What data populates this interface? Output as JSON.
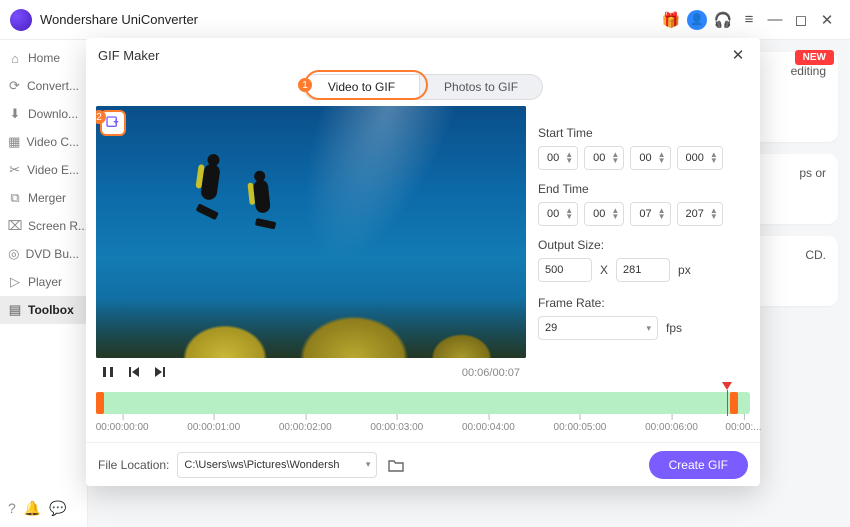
{
  "titlebar": {
    "app_name": "Wondershare UniConverter"
  },
  "sidebar": {
    "items": [
      {
        "label": "Home",
        "icon": "⌂"
      },
      {
        "label": "Convert...",
        "icon": "⟳"
      },
      {
        "label": "Downlo...",
        "icon": "⬇"
      },
      {
        "label": "Video C...",
        "icon": "▦"
      },
      {
        "label": "Video E...",
        "icon": "✂"
      },
      {
        "label": "Merger",
        "icon": "⧉"
      },
      {
        "label": "Screen R...",
        "icon": "⌧"
      },
      {
        "label": "DVD Bu...",
        "icon": "◎"
      },
      {
        "label": "Player",
        "icon": "▷"
      },
      {
        "label": "Toolbox",
        "icon": "▤"
      }
    ]
  },
  "bg": {
    "new_badge": "NEW",
    "card1_text": "editing",
    "card2_text": "ps or",
    "card3_text": "CD."
  },
  "modal": {
    "title": "GIF Maker",
    "tabs": {
      "video": "Video to GIF",
      "photo": "Photos to GIF",
      "step1": "1",
      "step2": "2"
    },
    "playback": {
      "time": "00:06/00:07"
    },
    "settings": {
      "start_label": "Start Time",
      "end_label": "End Time",
      "start": {
        "h": "00",
        "m": "00",
        "s": "00",
        "ms": "000"
      },
      "end": {
        "h": "00",
        "m": "00",
        "s": "07",
        "ms": "207"
      },
      "output_label": "Output Size:",
      "out_w": "500",
      "out_x": "X",
      "out_h": "281",
      "out_px": "px",
      "rate_label": "Frame Rate:",
      "rate_value": "29",
      "rate_unit": "fps"
    },
    "timeline": {
      "ticks": [
        "00:00:00:00",
        "00:00:01:00",
        "00:00:02:00",
        "00:00:03:00",
        "00:00:04:00",
        "00:00:05:00",
        "00:00:06:00",
        "00:00:..."
      ]
    },
    "footer": {
      "location_label": "File Location:",
      "location_value": "C:\\Users\\ws\\Pictures\\Wondersh",
      "create_label": "Create GIF"
    }
  }
}
